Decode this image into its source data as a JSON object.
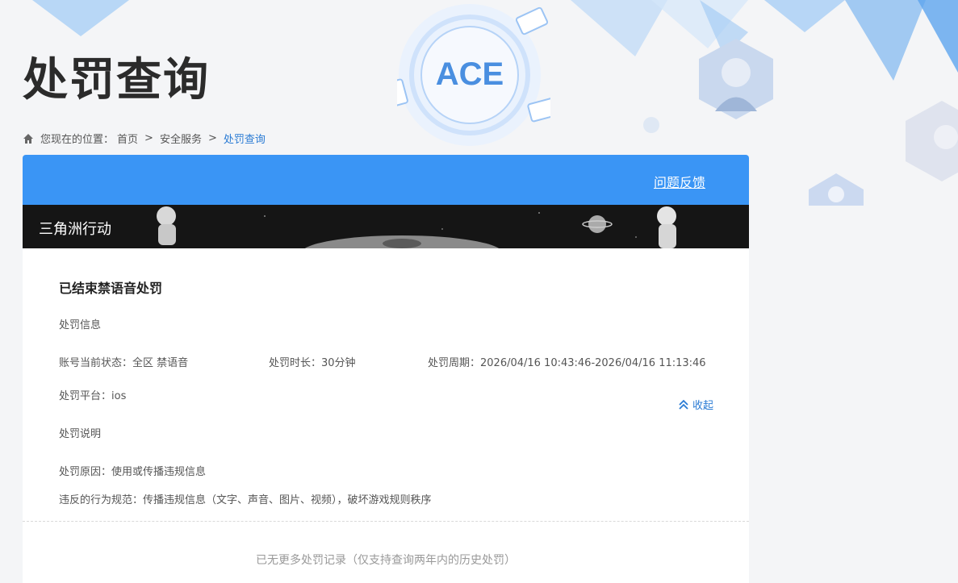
{
  "header": {
    "title": "处罚查询"
  },
  "breadcrumb": {
    "prefix": "您现在的位置：",
    "items": [
      "首页",
      "安全服务",
      "处罚查询"
    ],
    "separator": ">"
  },
  "logo": {
    "text": "ACE"
  },
  "card": {
    "feedback_label": "问题反馈",
    "game_name": "三角洲行动",
    "status_title": "已结束禁语音处罚",
    "info_section_label": "处罚信息",
    "account_status": "账号当前状态：全区 禁语音",
    "duration": "处罚时长：30分钟",
    "period": "处罚周期：2026/04/16 10:43:46-2026/04/16 11:13:46",
    "platform": "处罚平台：ios",
    "desc_section_label": "处罚说明",
    "reason": "处罚原因：使用或传播违规信息",
    "rule": "违反的行为规范：传播违规信息（文字、声音、图片、视频），破坏游戏规则秩序",
    "collapse_label": "收起",
    "no_more": "已无更多处罚记录（仅支持查询两年内的历史处罚）"
  },
  "colors": {
    "accent": "#3a95f5",
    "link": "#2a7bd4",
    "banner_bg": "#151515"
  }
}
